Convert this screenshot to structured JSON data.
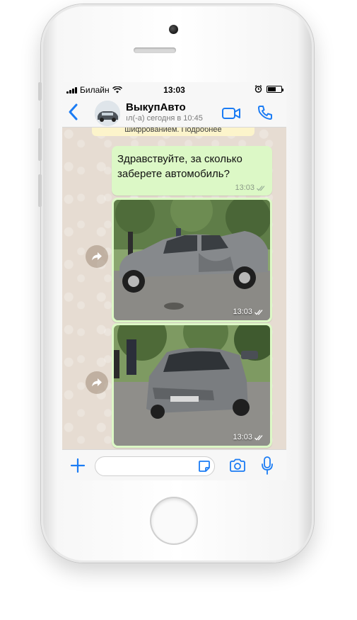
{
  "status_bar": {
    "carrier": "Билайн",
    "time": "13:03"
  },
  "header": {
    "contact_name": "ВыкупАвто",
    "last_seen": "ıл(-а) сегодня в 10:45"
  },
  "chat": {
    "notice_text": "шифрованием. Подробнее",
    "messages": [
      {
        "type": "text",
        "text": "Здравствуйте, за сколько заберете автомобиль?",
        "time": "13:03",
        "status": "read"
      },
      {
        "type": "image",
        "time": "13:03",
        "status": "read",
        "subject": "damaged-grey-car-side-view"
      },
      {
        "type": "image",
        "time": "13:03",
        "status": "read",
        "subject": "damaged-grey-car-front-view"
      }
    ]
  },
  "composer": {
    "placeholder": ""
  },
  "colors": {
    "accent": "#1b7cf4",
    "outgoing_bubble": "#dcf8c6",
    "chat_background": "#e6dcd2",
    "notice_background": "#fcf4cb"
  },
  "icons": {
    "back": "chevron-left-icon",
    "video": "video-camera-icon",
    "call": "phone-icon",
    "forward": "forward-arrow-icon",
    "read_receipt": "double-check-icon",
    "attach": "plus-icon",
    "sticker": "sticker-icon",
    "camera": "camera-icon",
    "mic": "microphone-icon"
  }
}
